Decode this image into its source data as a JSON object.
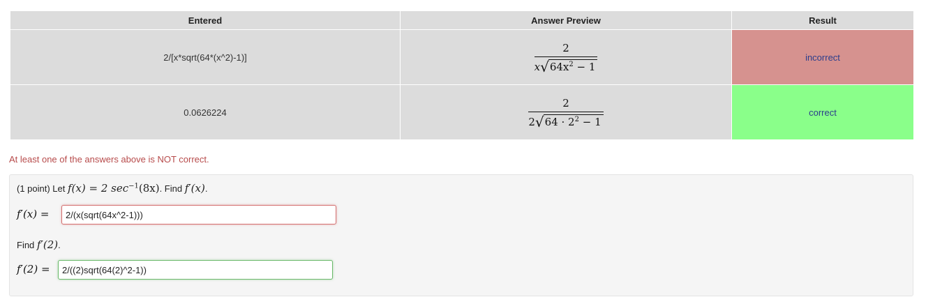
{
  "table": {
    "headers": [
      "Entered",
      "Answer Preview",
      "Result"
    ],
    "rows": [
      {
        "entered": "2/[x*sqrt(64*(x^2)-1)]",
        "preview_num": "2",
        "preview_den_pre": "x",
        "preview_den_rad": "64x",
        "preview_den_exp": "2",
        "preview_den_post": " − 1",
        "result": "incorrect"
      },
      {
        "entered": "0.0626224",
        "preview_num": "2",
        "preview_den_pre": "2",
        "preview_den_rad": "64 · 2",
        "preview_den_exp": "2",
        "preview_den_post": " − 1",
        "result": "correct"
      }
    ]
  },
  "status_message": "At least one of the answers above is NOT correct.",
  "problem": {
    "points": "(1 point) Let",
    "func_def": "f(x) = 2 sec",
    "func_exp": "−1",
    "func_arg": "(8x)",
    "find_text": ". Find",
    "find_target": "f′(x)",
    "answer1_label": "f′(x) =",
    "answer1_value": "2/(x(sqrt(64x^2-1)))",
    "find2_text": "Find",
    "find2_target": "f′(2)",
    "answer2_label": "f′(2) =",
    "answer2_value": "2/((2)sqrt(64(2)^2-1))"
  }
}
